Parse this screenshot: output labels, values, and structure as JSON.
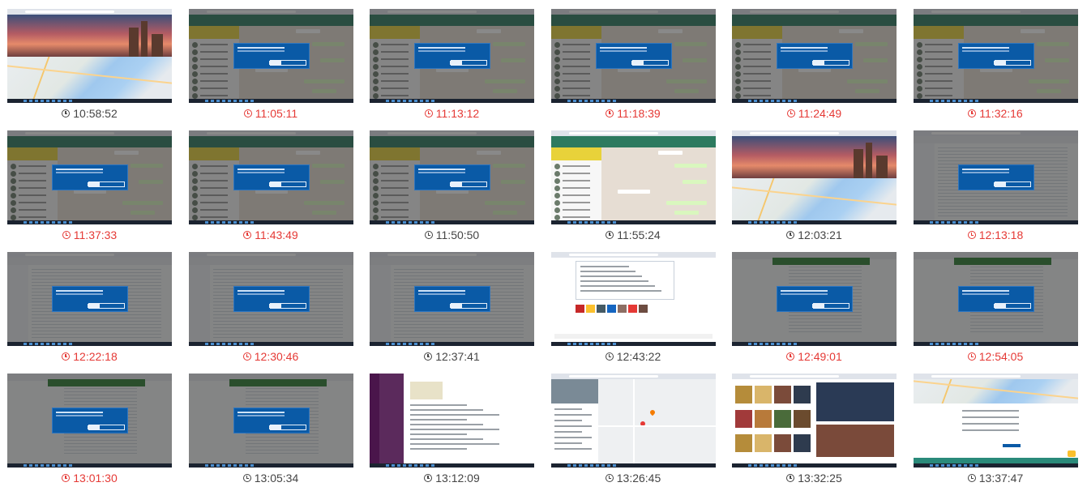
{
  "tiles": [
    {
      "time": "10:58:52",
      "alert": false,
      "view": "login-map"
    },
    {
      "time": "11:05:11",
      "alert": true,
      "view": "whatsapp-dialog"
    },
    {
      "time": "11:13:12",
      "alert": true,
      "view": "whatsapp-dialog"
    },
    {
      "time": "11:18:39",
      "alert": true,
      "view": "whatsapp-dialog"
    },
    {
      "time": "11:24:49",
      "alert": true,
      "view": "whatsapp-dialog"
    },
    {
      "time": "11:32:16",
      "alert": true,
      "view": "whatsapp-dialog"
    },
    {
      "time": "11:37:33",
      "alert": true,
      "view": "whatsapp-dialog"
    },
    {
      "time": "11:43:49",
      "alert": true,
      "view": "whatsapp-dialog"
    },
    {
      "time": "11:50:50",
      "alert": false,
      "view": "whatsapp-dialog"
    },
    {
      "time": "11:55:24",
      "alert": false,
      "view": "whatsapp"
    },
    {
      "time": "12:03:21",
      "alert": false,
      "view": "login-map"
    },
    {
      "time": "12:13:18",
      "alert": true,
      "view": "sheet-dialog"
    },
    {
      "time": "12:22:18",
      "alert": true,
      "view": "sheet-dialog"
    },
    {
      "time": "12:30:46",
      "alert": true,
      "view": "sheet-dialog"
    },
    {
      "time": "12:37:41",
      "alert": false,
      "view": "sheet-dialog"
    },
    {
      "time": "12:43:22",
      "alert": false,
      "view": "browser-search"
    },
    {
      "time": "12:49:01",
      "alert": true,
      "view": "green-dialog"
    },
    {
      "time": "12:54:05",
      "alert": true,
      "view": "green-dialog"
    },
    {
      "time": "13:01:30",
      "alert": true,
      "view": "green-dialog"
    },
    {
      "time": "13:05:34",
      "alert": false,
      "view": "green-dialog"
    },
    {
      "time": "13:12:09",
      "alert": false,
      "view": "slack"
    },
    {
      "time": "13:26:45",
      "alert": false,
      "view": "maps"
    },
    {
      "time": "13:32:25",
      "alert": false,
      "view": "news"
    },
    {
      "time": "13:37:47",
      "alert": false,
      "view": "login-form"
    }
  ],
  "icons": {
    "caption": "clock-icon"
  },
  "colors": {
    "alert": "#e53935",
    "normal": "#444444",
    "dialog": "#0a5aa6"
  }
}
